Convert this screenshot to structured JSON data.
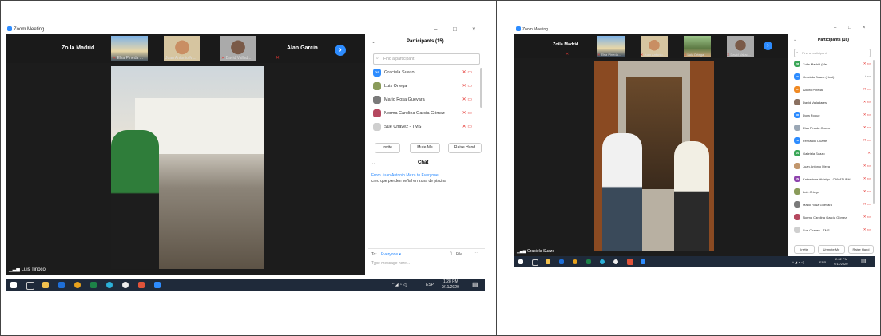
{
  "left": {
    "title": "Zoom Meeting",
    "window_controls": [
      "–",
      "□",
      "×"
    ],
    "thumbnails": {
      "tile1": "Zoila Madrid",
      "thumbs": [
        {
          "label": "Elsa Pineda ..."
        },
        {
          "label": "Juan Antonio M..."
        },
        {
          "label": "David Vallad..."
        }
      ],
      "tile_last": "Alan Garcia",
      "next": "›"
    },
    "speaker": "Luis Tinoco",
    "participants_title": "Participants (15)",
    "search_placeholder": "Find a participant",
    "participants": [
      {
        "initials": "GS",
        "name": "Graciela Suazo",
        "color": "#2d8cff"
      },
      {
        "initials": "",
        "name": "Luis Ortega",
        "color": "#8a9b5a"
      },
      {
        "initials": "",
        "name": "Mario Rosa Guevara",
        "color": "#7a7a7a"
      },
      {
        "initials": "",
        "name": "Norma Carolina García Gómez",
        "color": "#b5485f"
      },
      {
        "initials": "",
        "name": "Sue Chavez - TMS",
        "color": "#cfcfcf"
      }
    ],
    "buttons": {
      "invite": "Invite",
      "mute": "Mute Me",
      "raise": "Raise Hand"
    },
    "chat_title": "Chat",
    "chat_from": "From Juan Antonio Meza to Everyone:",
    "chat_msg": "creo que pierden señal en zona de piscina",
    "to_label": "To:",
    "to_value": "Everyone ▾",
    "file_label": "File",
    "message_placeholder": "Type message here...",
    "clock": {
      "time": "1:28 PM",
      "date": "9/11/2020",
      "lang": "ESP"
    }
  },
  "right": {
    "title": "Zoom Meeting",
    "window_controls": [
      "–",
      "□",
      "×"
    ],
    "thumbnails": {
      "tile1": "Zoila Madrid",
      "thumbs": [
        {
          "label": "Elsa Pineda..."
        },
        {
          "label": "Juan Antonio..."
        },
        {
          "label": "Luis Ortega"
        },
        {
          "label": "David Vallad..."
        }
      ],
      "next": "›"
    },
    "speaker": "Graciela Suazo",
    "participants_title": "Participants (16)",
    "search_placeholder": "Find a participant",
    "participants": [
      {
        "initials": "ZM",
        "name": "Zoila Madrid (Me)",
        "color": "#3aa657"
      },
      {
        "initials": "GS",
        "name": "Graciela Suazo (Host)",
        "color": "#2d8cff"
      },
      {
        "initials": "AP",
        "name": "Adolfo Pineda",
        "color": "#f08a24"
      },
      {
        "initials": "",
        "name": "David Valladares",
        "color": "#8a7060"
      },
      {
        "initials": "DR",
        "name": "Dora Roque",
        "color": "#2d8cff"
      },
      {
        "initials": "",
        "name": "Elsa Pineda Castro",
        "color": "#9aa7b5"
      },
      {
        "initials": "FD",
        "name": "Fernando Duarte",
        "color": "#2d8cff"
      },
      {
        "initials": "GS",
        "name": "Gabriela Suazo",
        "color": "#3aa657"
      },
      {
        "initials": "",
        "name": "Juan Antonio Meza",
        "color": "#c2976d"
      },
      {
        "initials": "KN",
        "name": "Katherinne Hidalgo - CANATURH",
        "color": "#8e44ad"
      },
      {
        "initials": "",
        "name": "Luis Ortega",
        "color": "#8a9b5a"
      },
      {
        "initials": "",
        "name": "Mario Rosa Guevara",
        "color": "#7a7a7a"
      },
      {
        "initials": "",
        "name": "Norma Carolina García Gómez",
        "color": "#b5485f"
      },
      {
        "initials": "",
        "name": "Sue Chavez - TMS",
        "color": "#cfcfcf"
      }
    ],
    "buttons": {
      "invite": "Invite",
      "mute": "Unmute Me",
      "raise": "Raise Hand"
    },
    "clock": {
      "time": "2:02 PM",
      "date": "9/11/2020",
      "lang": "ESP"
    }
  }
}
